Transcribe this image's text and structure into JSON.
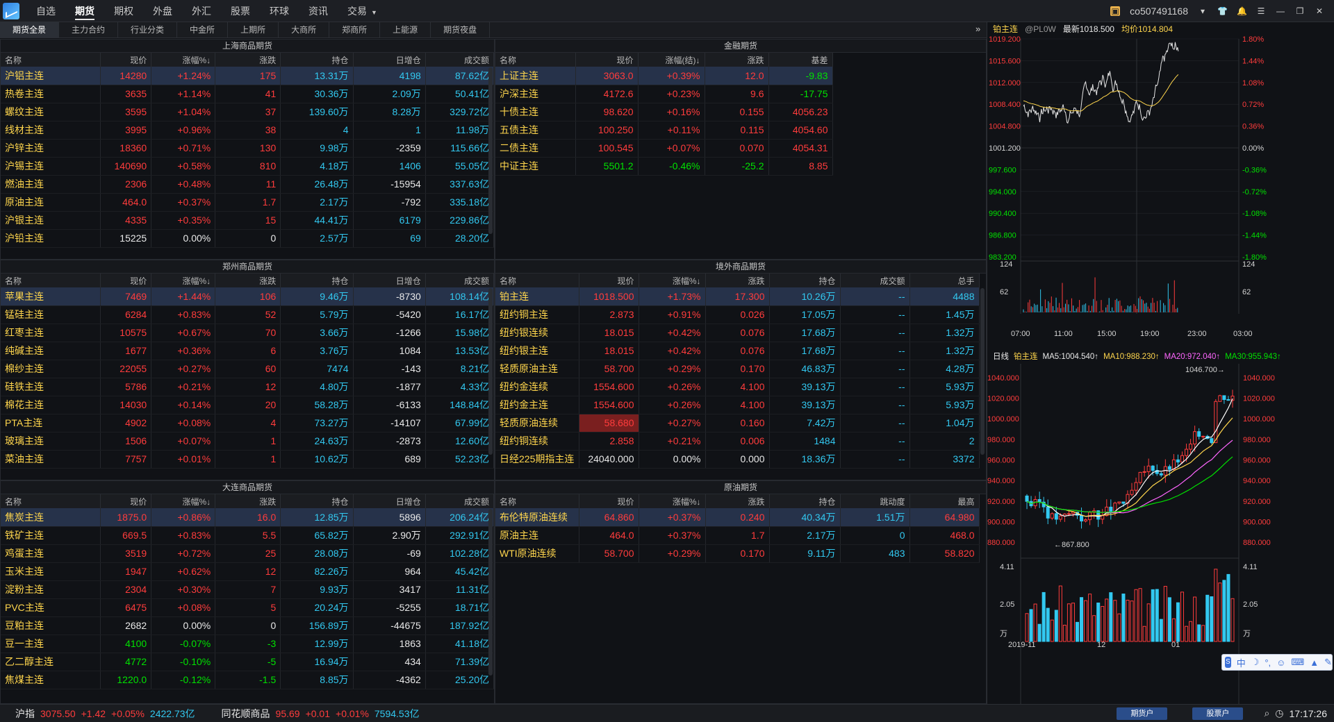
{
  "app": {
    "main_tabs": [
      "自选",
      "期货",
      "期权",
      "外盘",
      "外汇",
      "股票",
      "环球",
      "资讯",
      "交易"
    ],
    "active_main": 1,
    "user": "co507491168",
    "trade_arrow": "▼"
  },
  "sub_tabs": [
    "期货全景",
    "主力合约",
    "行业分类",
    "中金所",
    "上期所",
    "大商所",
    "郑商所",
    "上能源",
    "期货夜盘"
  ],
  "sh": {
    "title": "上海商品期货",
    "cols": [
      "名称",
      "现价",
      "涨幅%↓",
      "涨跌",
      "持仓",
      "日增仓",
      "成交额"
    ],
    "rows": [
      [
        "沪铝主连",
        "14280",
        "+1.24%",
        "175",
        "13.31万",
        "4198",
        "87.62亿"
      ],
      [
        "热卷主连",
        "3635",
        "+1.14%",
        "41",
        "30.36万",
        "2.09万",
        "50.41亿"
      ],
      [
        "螺纹主连",
        "3595",
        "+1.04%",
        "37",
        "139.60万",
        "8.28万",
        "329.72亿"
      ],
      [
        "线材主连",
        "3995",
        "+0.96%",
        "38",
        "4",
        "1",
        "11.98万"
      ],
      [
        "沪锌主连",
        "18360",
        "+0.71%",
        "130",
        "9.98万",
        "-2359",
        "115.66亿"
      ],
      [
        "沪锡主连",
        "140690",
        "+0.58%",
        "810",
        "4.18万",
        "1406",
        "55.05亿"
      ],
      [
        "燃油主连",
        "2306",
        "+0.48%",
        "11",
        "26.48万",
        "-15954",
        "337.63亿"
      ],
      [
        "原油主连",
        "464.0",
        "+0.37%",
        "1.7",
        "2.17万",
        "-792",
        "335.18亿"
      ],
      [
        "沪银主连",
        "4335",
        "+0.35%",
        "15",
        "44.41万",
        "6179",
        "229.86亿"
      ],
      [
        "沪铅主连",
        "15225",
        "0.00%",
        "0",
        "2.57万",
        "69",
        "28.20亿"
      ]
    ]
  },
  "fin": {
    "title": "金融期货",
    "cols": [
      "名称",
      "现价",
      "涨幅(结)↓",
      "涨跌",
      "基差"
    ],
    "rows": [
      [
        "上证主连",
        "3063.0",
        "+0.39%",
        "12.0",
        "-9.83"
      ],
      [
        "沪深主连",
        "4172.6",
        "+0.23%",
        "9.6",
        "-17.75"
      ],
      [
        "十债主连",
        "98.620",
        "+0.16%",
        "0.155",
        "4056.23"
      ],
      [
        "五债主连",
        "100.250",
        "+0.11%",
        "0.115",
        "4054.60"
      ],
      [
        "二债主连",
        "100.545",
        "+0.07%",
        "0.070",
        "4054.31"
      ],
      [
        "中证主连",
        "5501.2",
        "-0.46%",
        "-25.2",
        "8.85"
      ]
    ]
  },
  "zz": {
    "title": "郑州商品期货",
    "cols": [
      "名称",
      "现价",
      "涨幅%↓",
      "涨跌",
      "持仓",
      "日增仓",
      "成交额"
    ],
    "rows": [
      [
        "苹果主连",
        "7469",
        "+1.44%",
        "106",
        "9.46万",
        "-8730",
        "108.14亿"
      ],
      [
        "锰硅主连",
        "6284",
        "+0.83%",
        "52",
        "5.79万",
        "-5420",
        "16.17亿"
      ],
      [
        "红枣主连",
        "10575",
        "+0.67%",
        "70",
        "3.66万",
        "-1266",
        "15.98亿"
      ],
      [
        "纯碱主连",
        "1677",
        "+0.36%",
        "6",
        "3.76万",
        "1084",
        "13.53亿"
      ],
      [
        "棉纱主连",
        "22055",
        "+0.27%",
        "60",
        "7474",
        "-143",
        "8.21亿"
      ],
      [
        "硅铁主连",
        "5786",
        "+0.21%",
        "12",
        "4.80万",
        "-1877",
        "4.33亿"
      ],
      [
        "棉花主连",
        "14030",
        "+0.14%",
        "20",
        "58.28万",
        "-6133",
        "148.84亿"
      ],
      [
        "PTA主连",
        "4902",
        "+0.08%",
        "4",
        "73.27万",
        "-14107",
        "67.99亿"
      ],
      [
        "玻璃主连",
        "1506",
        "+0.07%",
        "1",
        "24.63万",
        "-2873",
        "12.60亿"
      ],
      [
        "菜油主连",
        "7757",
        "+0.01%",
        "1",
        "10.62万",
        "689",
        "52.23亿"
      ]
    ]
  },
  "ov": {
    "title": "境外商品期货",
    "cols": [
      "名称",
      "现价",
      "涨幅%↓",
      "涨跌",
      "持仓",
      "成交额",
      "总手"
    ],
    "rows": [
      [
        "铂主连",
        "1018.500",
        "+1.73%",
        "17.300",
        "10.26万",
        "--",
        "4488"
      ],
      [
        "纽约铜主连",
        "2.873",
        "+0.91%",
        "0.026",
        "17.05万",
        "--",
        "1.45万"
      ],
      [
        "纽约银连续",
        "18.015",
        "+0.42%",
        "0.076",
        "17.68万",
        "--",
        "1.32万"
      ],
      [
        "纽约银主连",
        "18.015",
        "+0.42%",
        "0.076",
        "17.68万",
        "--",
        "1.32万"
      ],
      [
        "轻质原油主连",
        "58.700",
        "+0.29%",
        "0.170",
        "46.83万",
        "--",
        "4.28万"
      ],
      [
        "纽约金连续",
        "1554.600",
        "+0.26%",
        "4.100",
        "39.13万",
        "--",
        "5.93万"
      ],
      [
        "纽约金主连",
        "1554.600",
        "+0.26%",
        "4.100",
        "39.13万",
        "--",
        "5.93万"
      ],
      [
        "轻质原油连续",
        "58.680",
        "+0.27%",
        "0.160",
        "7.42万",
        "--",
        "1.04万"
      ],
      [
        "纽约铜连续",
        "2.858",
        "+0.21%",
        "0.006",
        "1484",
        "--",
        "2"
      ],
      [
        "日经225期指主连",
        "24040.000",
        "0.00%",
        "0.000",
        "18.36万",
        "--",
        "3372"
      ]
    ]
  },
  "dl": {
    "title": "大连商品期货",
    "cols": [
      "名称",
      "现价",
      "涨幅%↓",
      "涨跌",
      "持仓",
      "日增仓",
      "成交额"
    ],
    "rows": [
      [
        "焦炭主连",
        "1875.0",
        "+0.86%",
        "16.0",
        "12.85万",
        "5896",
        "206.24亿"
      ],
      [
        "铁矿主连",
        "669.5",
        "+0.83%",
        "5.5",
        "65.82万",
        "2.90万",
        "292.91亿"
      ],
      [
        "鸡蛋主连",
        "3519",
        "+0.72%",
        "25",
        "28.08万",
        "-69",
        "102.28亿"
      ],
      [
        "玉米主连",
        "1947",
        "+0.62%",
        "12",
        "82.26万",
        "964",
        "45.42亿"
      ],
      [
        "淀粉主连",
        "2304",
        "+0.30%",
        "7",
        "9.93万",
        "3417",
        "11.31亿"
      ],
      [
        "PVC主连",
        "6475",
        "+0.08%",
        "5",
        "20.24万",
        "-5255",
        "18.71亿"
      ],
      [
        "豆粕主连",
        "2682",
        "0.00%",
        "0",
        "156.89万",
        "-44675",
        "187.92亿"
      ],
      [
        "豆一主连",
        "4100",
        "-0.07%",
        "-3",
        "12.99万",
        "1863",
        "41.18亿"
      ],
      [
        "乙二醇主连",
        "4772",
        "-0.10%",
        "-5",
        "16.94万",
        "434",
        "71.39亿"
      ],
      [
        "焦煤主连",
        "1220.0",
        "-0.12%",
        "-1.5",
        "8.85万",
        "-4362",
        "25.20亿"
      ]
    ]
  },
  "oil": {
    "title": "原油期货",
    "cols": [
      "名称",
      "现价",
      "涨幅%↓",
      "涨跌",
      "持仓",
      "跳动度",
      "最高"
    ],
    "rows": [
      [
        "布伦特原油连续",
        "64.860",
        "+0.37%",
        "0.240",
        "40.34万",
        "1.51万",
        "64.980"
      ],
      [
        "原油主连",
        "464.0",
        "+0.37%",
        "1.7",
        "2.17万",
        "0",
        "468.0"
      ],
      [
        "WTI原油连续",
        "58.700",
        "+0.29%",
        "0.170",
        "9.11万",
        "483",
        "58.820"
      ]
    ]
  },
  "intraday": {
    "name": "铂主连",
    "code": "@PL0W",
    "last_label": "最新1018.500",
    "avg_label": "均价1014.804",
    "left_ticks": [
      "1019.200",
      "1015.600",
      "1012.000",
      "1008.400",
      "1004.800",
      "1001.200",
      "997.600",
      "994.000",
      "990.400",
      "986.800",
      "983.200"
    ],
    "right_ticks": [
      "1.80%",
      "1.44%",
      "1.08%",
      "0.72%",
      "0.36%",
      "0.00%",
      "-0.36%",
      "-0.72%",
      "-1.08%",
      "-1.44%",
      "-1.80%"
    ],
    "vol_ticks": [
      "124",
      "62"
    ],
    "time_ticks": [
      "07:00",
      "11:00",
      "15:00",
      "19:00",
      "23:00",
      "03:00"
    ]
  },
  "kline": {
    "period": "日线",
    "name": "铂主连",
    "ma5": "MA5:1004.540↑",
    "ma10": "MA10:988.230↑",
    "ma20": "MA20:972.040↑",
    "ma30": "MA30:955.943↑",
    "ticks": [
      "1040.000",
      "1020.000",
      "1000.000",
      "980.000",
      "960.000",
      "940.000",
      "920.000",
      "900.000",
      "880.000"
    ],
    "high_label": "1046.700→",
    "low_label": "←867.800",
    "vol_ticks": [
      "4.11",
      "2.05",
      "万"
    ],
    "date_ticks": [
      "2019-11",
      "12",
      "01"
    ]
  },
  "status": {
    "idx1_name": "沪指",
    "idx1_price": "3075.50",
    "idx1_chg": "+1.42",
    "idx1_pct": "+0.05%",
    "idx1_amt": "2422.73亿",
    "idx2_name": "同花顺商品",
    "idx2_price": "95.69",
    "idx2_chg": "+0.01",
    "idx2_pct": "+0.01%",
    "idx2_amt": "7594.53亿",
    "btn1": "期货户",
    "btn2": "股票户",
    "time": "17:17:26"
  },
  "ime": {
    "label": "中"
  },
  "colors": {
    "up": "#ff3c3c",
    "down": "#00e200",
    "accent": "#32c8f0"
  }
}
